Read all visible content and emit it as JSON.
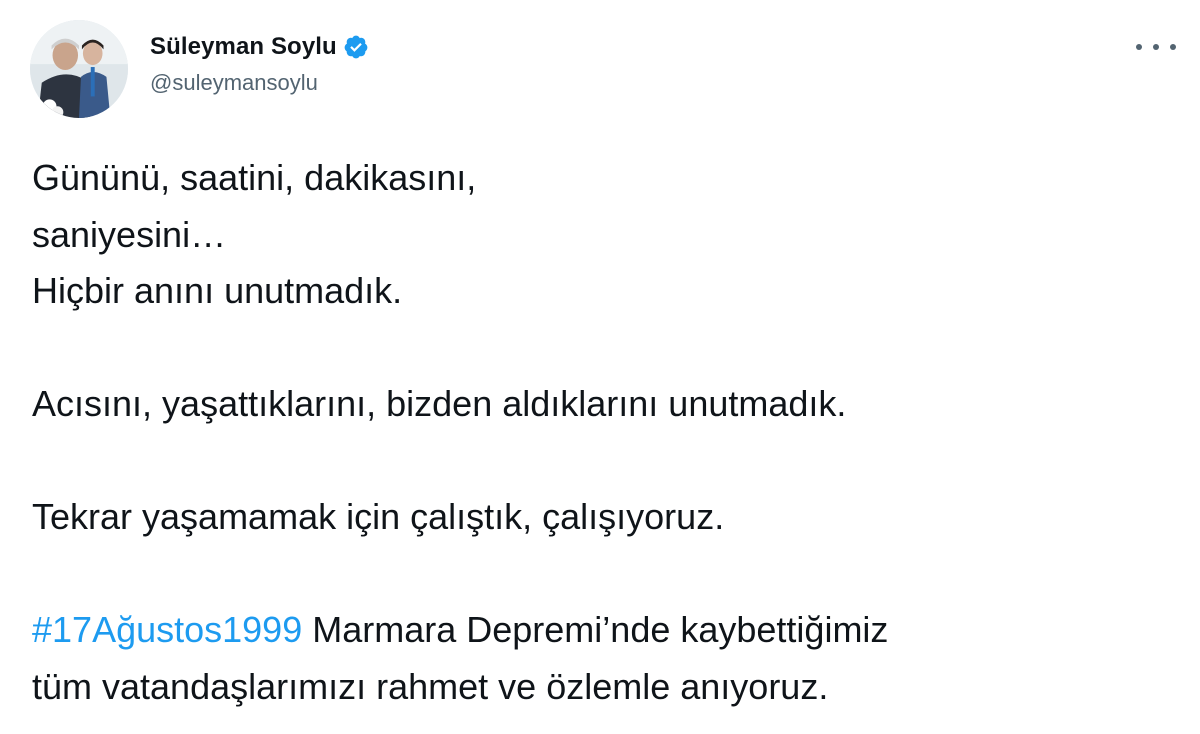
{
  "author": {
    "display_name": "Süleyman Soylu",
    "handle": "@suleymansoylu",
    "verified": true,
    "avatar_icon": "profile-photo"
  },
  "menu": {
    "icon": "more-options-icon"
  },
  "tweet": {
    "line_1": "Gününü, saatini, dakikasını,",
    "line_2": "saniyesini…",
    "line_3": "Hiçbir anını unutmadık.",
    "line_4": "Acısını, yaşattıklarını, bizden aldıklarını unutmadık.",
    "line_5": "Tekrar yaşamamak için çalıştık, çalışıyoruz.",
    "hashtag": "#17Ağustos1999",
    "line_6_rest": " Marmara Depremi’nde kaybettiğimiz",
    "line_7": "tüm vatandaşlarımızı rahmet ve özlemle anıyoruz."
  },
  "colors": {
    "text": "#0f1419",
    "secondary": "#536471",
    "accent": "#1d9bf0"
  }
}
